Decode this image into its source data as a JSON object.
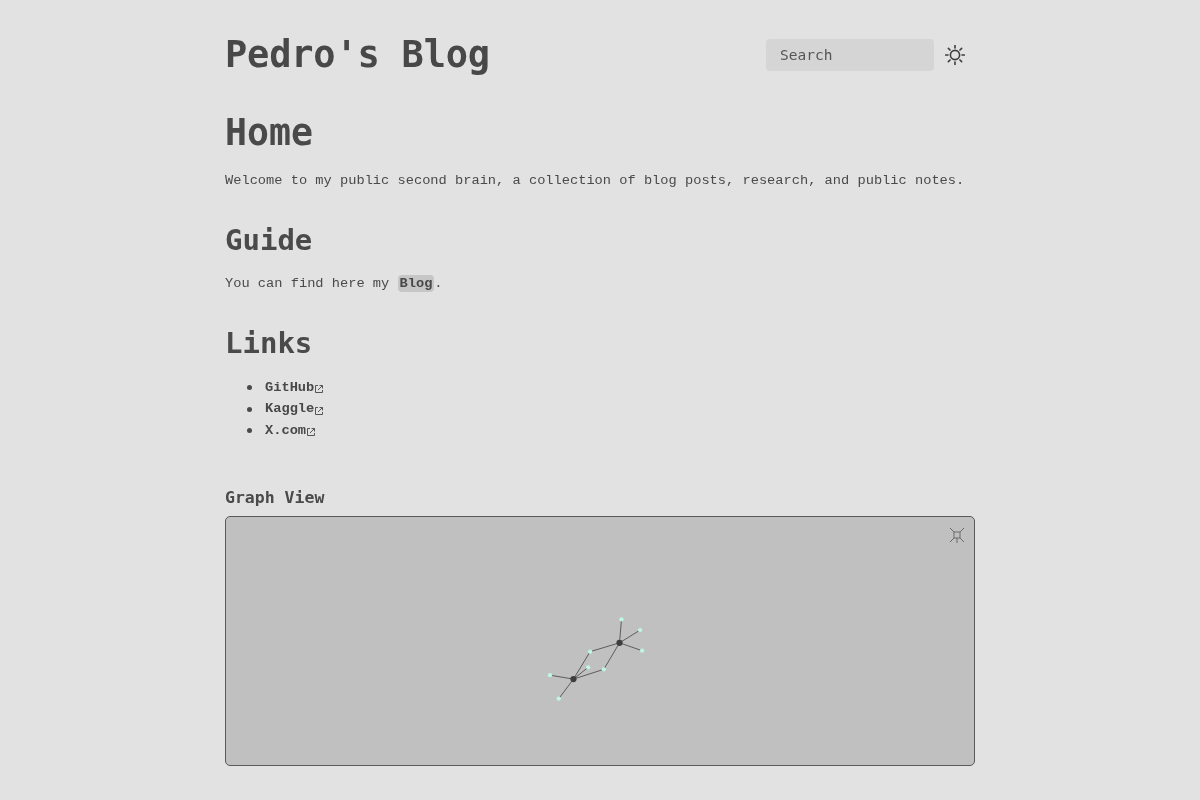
{
  "header": {
    "title": "Pedro's Blog",
    "search": {
      "placeholder": "Search"
    }
  },
  "article": {
    "title": "Home",
    "intro": "Welcome to my public second brain, a collection of blog posts, research, and public notes.",
    "sections": [
      {
        "kind": "paragraph",
        "heading": "Guide",
        "text": "You can find here my ",
        "link": "Blog",
        "after": "."
      },
      {
        "kind": "links",
        "heading": "Links",
        "links": [
          "GitHub",
          "Kaggle",
          "X.com"
        ]
      }
    ]
  },
  "graph": {
    "title": "Graph View"
  }
}
